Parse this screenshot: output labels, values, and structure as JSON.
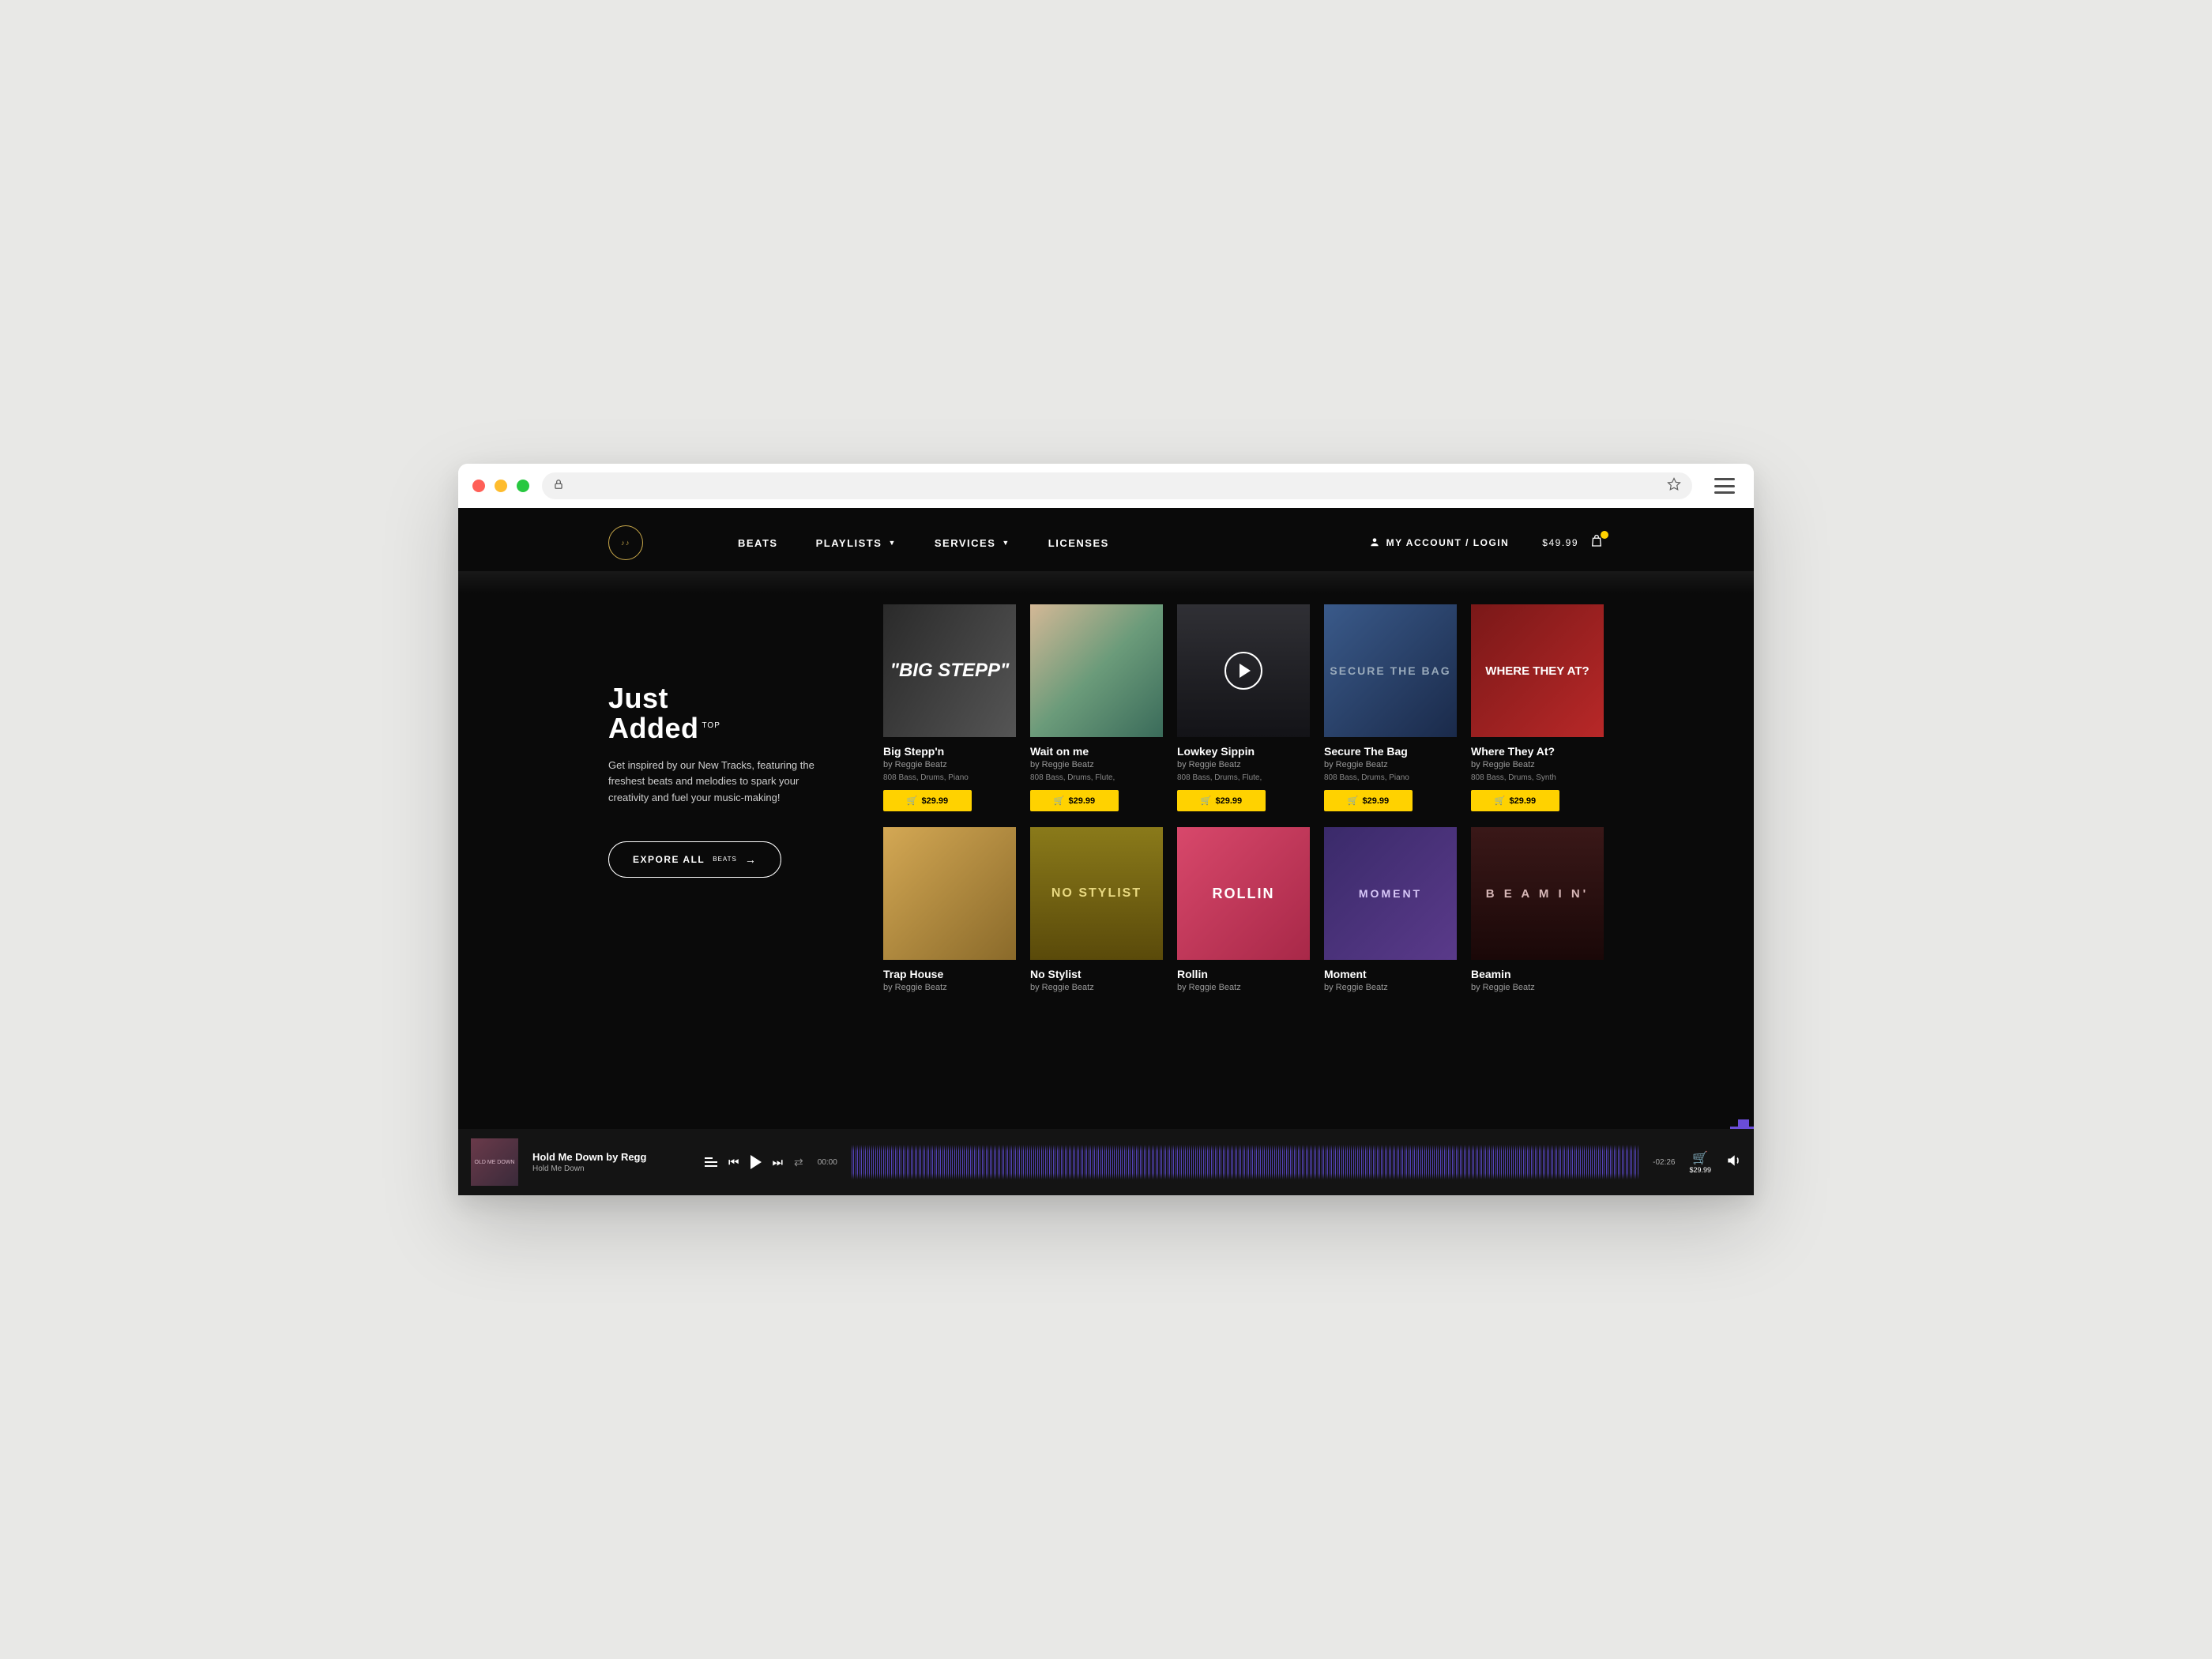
{
  "nav": {
    "links": [
      "BEATS",
      "PLAYLISTS",
      "SERVICES",
      "LICENSES"
    ],
    "account": "MY ACCOUNT / LOGIN",
    "cart_total": "$49.99"
  },
  "section": {
    "title_line1": "Just",
    "title_line2": "Added",
    "title_sup": "TOP",
    "description": "Get inspired by our New Tracks, featuring the freshest beats and melodies to spark your creativity and fuel your music-making!",
    "explore_label": "EXPORE ALL",
    "explore_small": "BEATS"
  },
  "tracks": [
    {
      "title": "Big Stepp'n",
      "artist": "by Reggie Beatz",
      "tags": "808 Bass, Drums, Piano",
      "price": "$29.99",
      "cover_text": "\"BIG STEPP\""
    },
    {
      "title": "Wait on me",
      "artist": "by Reggie Beatz",
      "tags": "808 Bass, Drums, Flute,",
      "price": "$29.99",
      "cover_text": ""
    },
    {
      "title": "Lowkey Sippin",
      "artist": "by Reggie Beatz",
      "tags": "808 Bass, Drums, Flute,",
      "price": "$29.99",
      "cover_text": "",
      "playing": true
    },
    {
      "title": "Secure The Bag",
      "artist": "by Reggie Beatz",
      "tags": "808 Bass, Drums, Piano",
      "price": "$29.99",
      "cover_text": "SECURE THE BAG"
    },
    {
      "title": "Where They At?",
      "artist": "by Reggie Beatz",
      "tags": "808 Bass, Drums, Synth",
      "price": "$29.99",
      "cover_text": "WHERE THEY AT?"
    },
    {
      "title": "Trap House",
      "artist": "by Reggie Beatz",
      "tags": "",
      "price": "",
      "cover_text": ""
    },
    {
      "title": "No Stylist",
      "artist": "by Reggie Beatz",
      "tags": "",
      "price": "",
      "cover_text": "NO STYLIST"
    },
    {
      "title": "Rollin",
      "artist": "by Reggie Beatz",
      "tags": "",
      "price": "",
      "cover_text": "ROLLIN"
    },
    {
      "title": "Moment",
      "artist": "by Reggie Beatz",
      "tags": "",
      "price": "",
      "cover_text": "MOMENT"
    },
    {
      "title": "Beamin",
      "artist": "by Reggie Beatz",
      "tags": "",
      "price": "",
      "cover_text": "B E A M I N'"
    }
  ],
  "player": {
    "title": "Hold Me Down by Regg",
    "subtitle": "Hold Me Down",
    "cover_text": "OLD ME DOWN",
    "time_elapsed": "00:00",
    "time_total": "-02:26",
    "cart_price": "$29.99"
  },
  "colors": {
    "accent_yellow": "#ffd200",
    "accent_purple": "#6a4dd8",
    "gold": "#c9a84a"
  }
}
